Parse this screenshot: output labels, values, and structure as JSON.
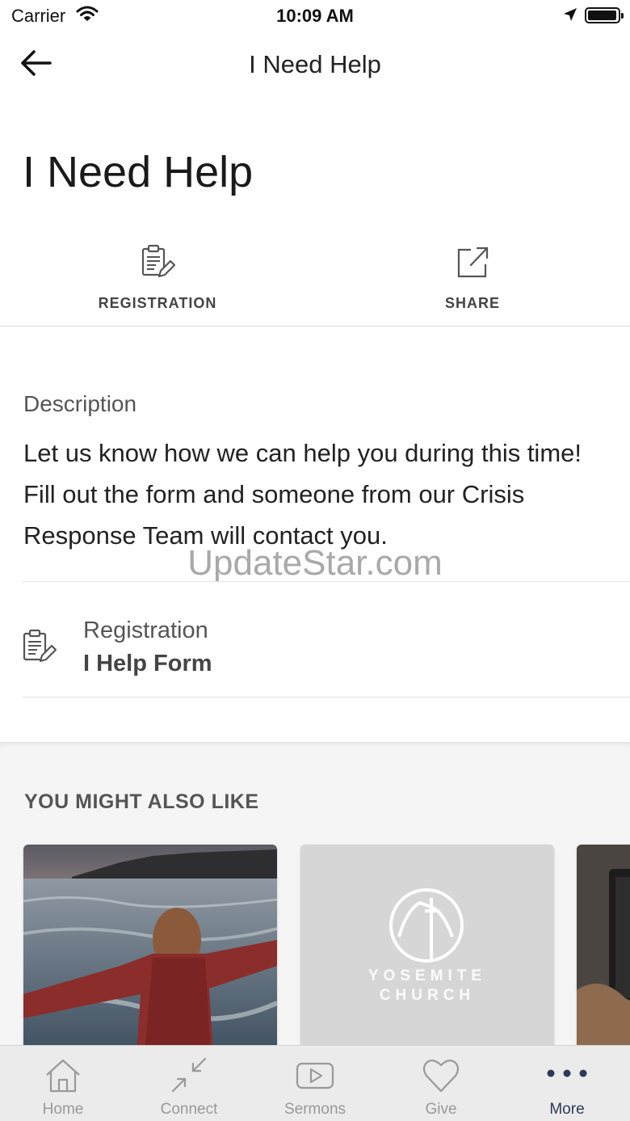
{
  "status_bar": {
    "carrier": "Carrier",
    "time": "10:09 AM"
  },
  "nav": {
    "title": "I Need Help"
  },
  "page": {
    "title": "I Need Help"
  },
  "actions": [
    {
      "label": "REGISTRATION",
      "icon": "clipboard-edit-icon"
    },
    {
      "label": "SHARE",
      "icon": "share-icon"
    }
  ],
  "description": {
    "heading": "Description",
    "body": "Let us know how we can help you during this time! Fill out the form and someone from our Crisis Response Team will contact you."
  },
  "watermark": "UpdateStar.com",
  "registration": {
    "kind": "Registration",
    "name": "I Help Form"
  },
  "related": {
    "heading": "YOU MIGHT ALSO LIKE",
    "cards": [
      {
        "image": "woman-at-beach-photo"
      },
      {
        "line1": "YOSEMITE",
        "line2": "CHURCH"
      },
      {
        "image": "partial-photo"
      }
    ]
  },
  "tabs": [
    {
      "label": "Home",
      "icon": "home-icon"
    },
    {
      "label": "Connect",
      "icon": "connect-icon"
    },
    {
      "label": "Sermons",
      "icon": "play-icon"
    },
    {
      "label": "Give",
      "icon": "heart-icon"
    },
    {
      "label": "More",
      "icon": "more-icon",
      "active": true
    }
  ],
  "colors": {
    "accent": "#2b3a56",
    "tab_inactive": "#999999",
    "background": "#ffffff"
  }
}
